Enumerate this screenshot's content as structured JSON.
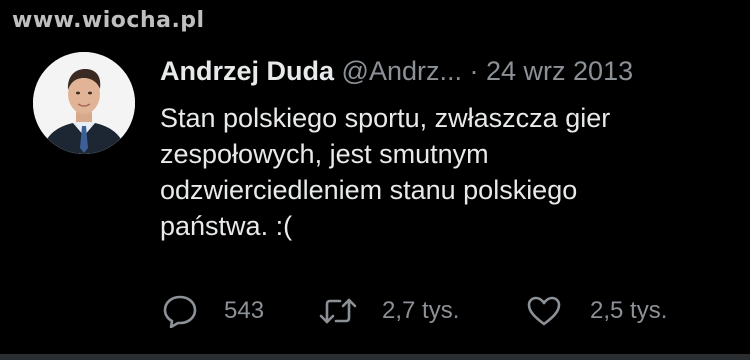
{
  "watermark": "www.wiocha.pl",
  "tweet": {
    "author_name": "Andrzej Duda",
    "author_handle": "@Andrz...",
    "separator": "·",
    "date": "24 wrz 2013",
    "text_lines": [
      "Stan polskiego sportu, zwłaszcza gier",
      "zespołowych, jest smutnym",
      "odzwierciedleniem stanu polskiego",
      "państwa. :("
    ],
    "actions": {
      "reply_count": "543",
      "retweet_count": "2,7 tys.",
      "like_count": "2,5 tys."
    }
  },
  "icons": {
    "reply": "reply-icon",
    "retweet": "retweet-icon",
    "like": "heart-icon"
  },
  "colors": {
    "background": "#000000",
    "text": "#e7e9ea",
    "muted": "#8b9196"
  }
}
